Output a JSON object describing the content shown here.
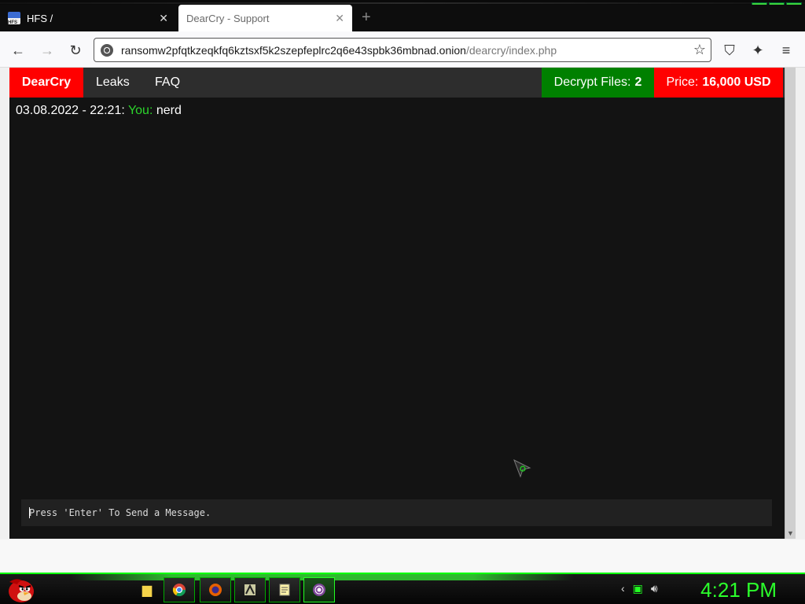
{
  "browser": {
    "tabs": [
      {
        "title": "HFS /",
        "favicon": "hfs-icon"
      },
      {
        "title": "DearCry - Support",
        "active": true
      }
    ],
    "url_host": "ransomw2pfqtkzeqkfq6kztsxf5k2szepfeplrc2q6e43spbk36mbnad.onion",
    "url_path": "/dearcry/index.php"
  },
  "site": {
    "brand": "DearCry",
    "nav": [
      "Leaks",
      "FAQ"
    ],
    "decrypt_label": "Decrypt Files:",
    "decrypt_count": "2",
    "price_label": "Price:",
    "price_value": "16,000 USD",
    "colors": {
      "brand": "#ff0000",
      "decrypt": "#008000",
      "background": "#131313",
      "you": "#2cd52c"
    }
  },
  "chat": {
    "messages": [
      {
        "timestamp": "03.08.2022 - 22:21:",
        "sender": "You:",
        "text": "nerd"
      }
    ],
    "input_placeholder": "Press 'Enter' To Send a Message."
  },
  "taskbar": {
    "clock": "4:21 PM",
    "apps": [
      "folder-icon",
      "chrome-icon",
      "firefox-icon",
      "app-icon",
      "notepad-icon",
      "tor-icon"
    ]
  }
}
